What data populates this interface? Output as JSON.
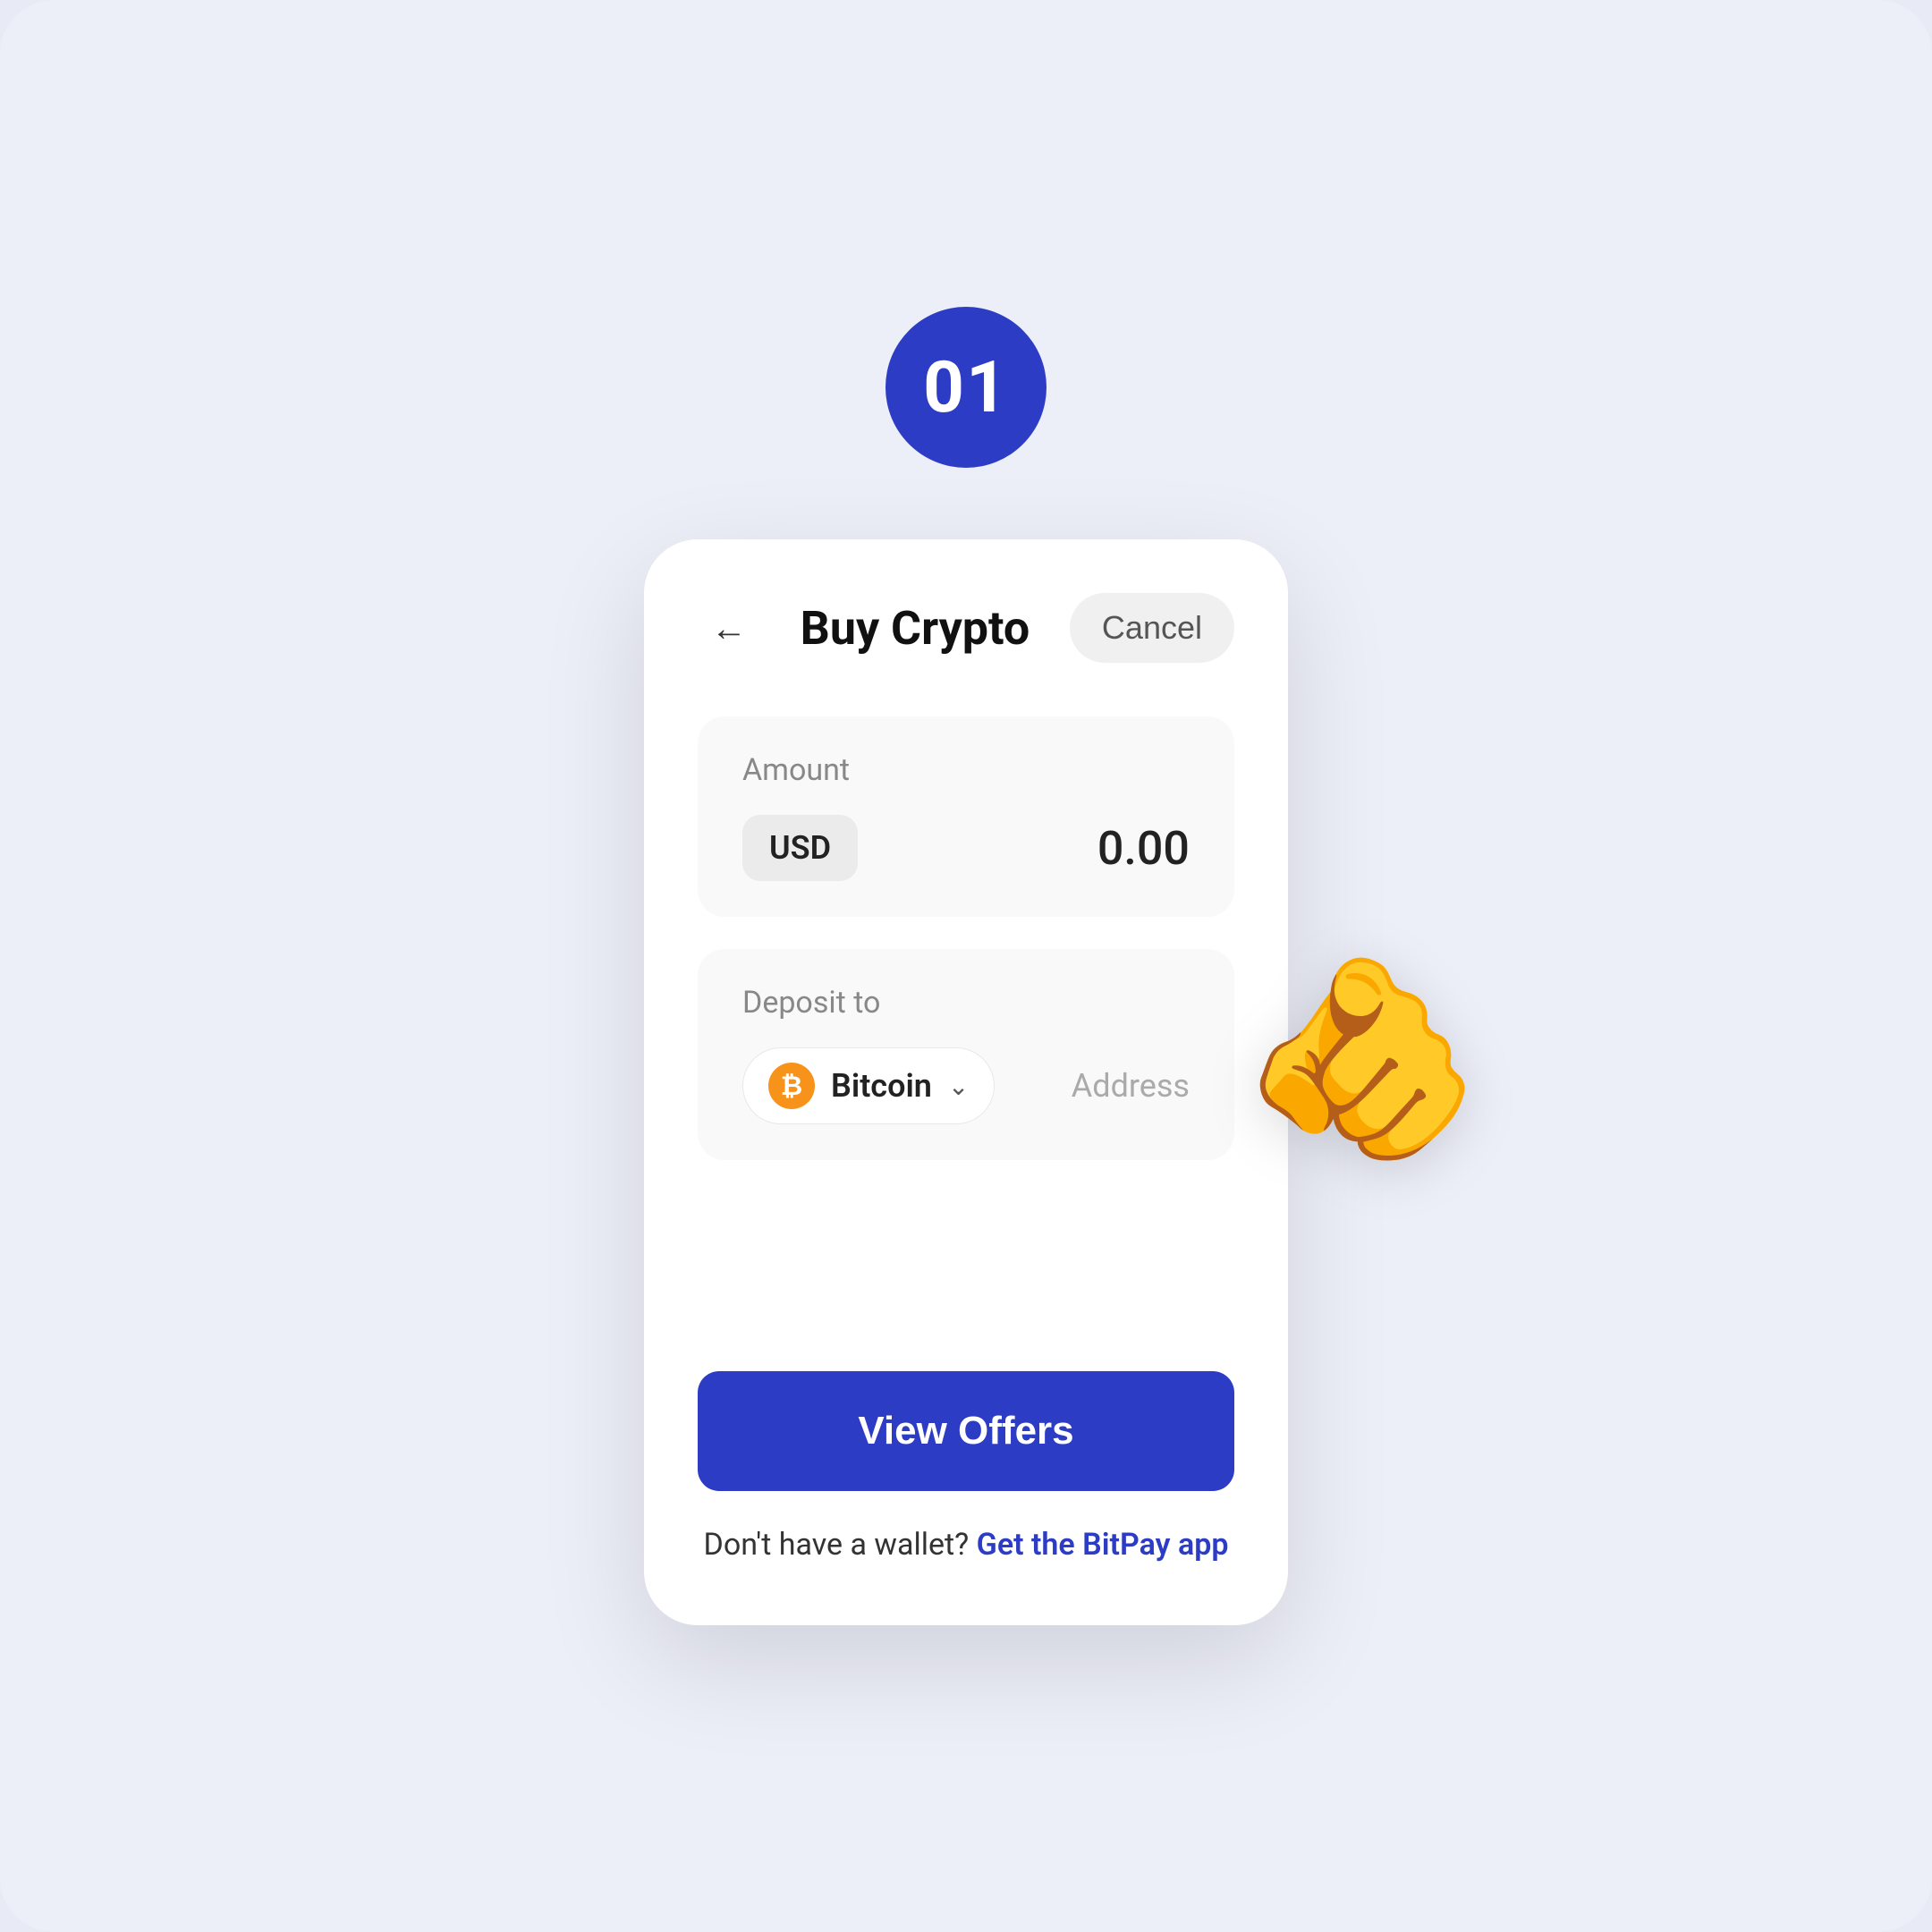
{
  "page": {
    "background_color": "#eceef8",
    "step_number": "01"
  },
  "header": {
    "title": "Buy Crypto",
    "back_label": "←",
    "cancel_label": "Cancel"
  },
  "amount_section": {
    "label": "Amount",
    "currency": "USD",
    "value": "0.00"
  },
  "deposit_section": {
    "label": "Deposit to",
    "crypto_name": "Bitcoin",
    "address_placeholder": "Address"
  },
  "actions": {
    "view_offers_label": "View Offers",
    "no_wallet_text": "Don't have a wallet?",
    "get_app_link": "Get the BitPay app"
  },
  "icons": {
    "bitcoin_symbol": "₿",
    "chevron_down": "⌄",
    "back_arrow": "←"
  }
}
